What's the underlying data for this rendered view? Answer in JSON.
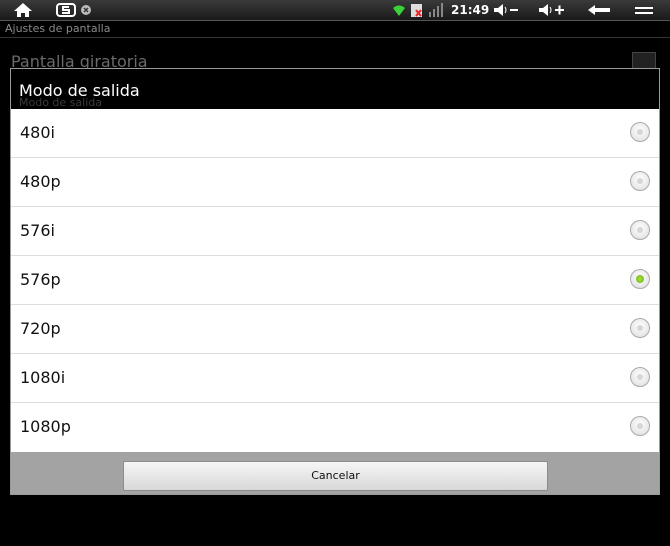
{
  "statusbar": {
    "icons_left": [
      "home-icon",
      "s-app-icon",
      "close-small-icon"
    ],
    "icons_right": [
      "wifi-icon",
      "sd-card-icon",
      "signal-icon",
      "volume-down-icon",
      "volume-up-icon",
      "back-icon",
      "menu-icon"
    ],
    "time": "21:49"
  },
  "background_screen": {
    "title": "Ajustes de pantalla",
    "item": "Pantalla giratoria",
    "subtext": "Modo de salida"
  },
  "dialog": {
    "title": "Modo de salida",
    "options": [
      {
        "label": "480i",
        "selected": false
      },
      {
        "label": "480p",
        "selected": false
      },
      {
        "label": "576i",
        "selected": false
      },
      {
        "label": "576p",
        "selected": true
      },
      {
        "label": "720p",
        "selected": false
      },
      {
        "label": "1080i",
        "selected": false
      },
      {
        "label": "1080p",
        "selected": false
      }
    ],
    "cancel_label": "Cancelar",
    "selected_color": "#7ac520"
  }
}
